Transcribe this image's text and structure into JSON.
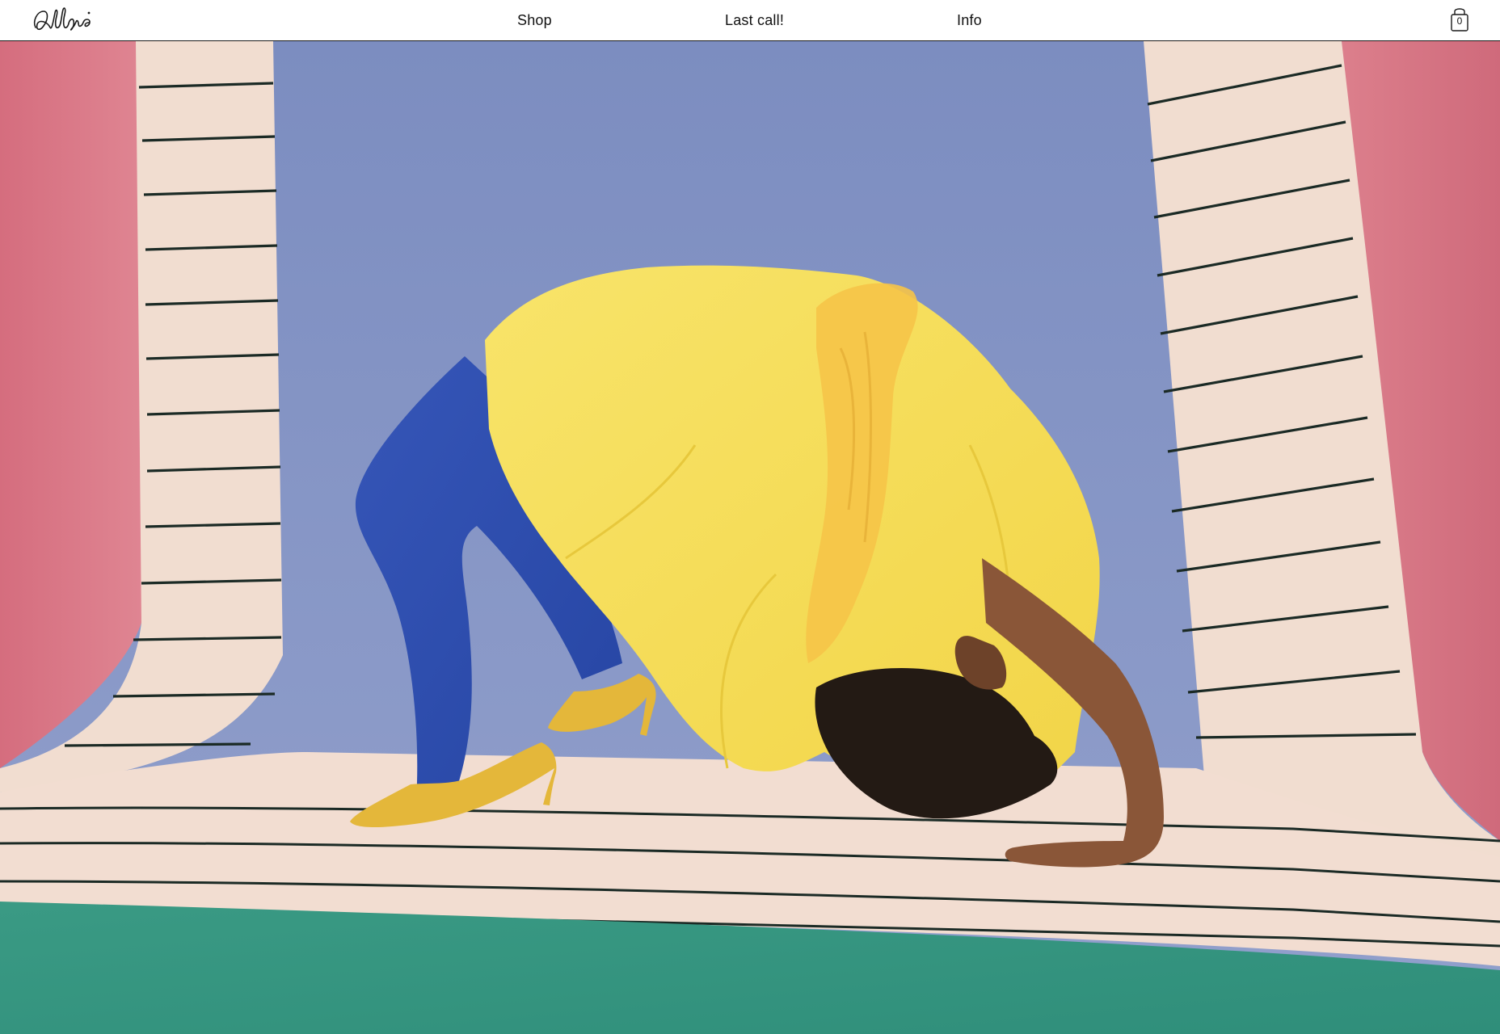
{
  "header": {
    "logo_text": "Aelfie",
    "nav": {
      "shop": "Shop",
      "last_call": "Last call!",
      "info": "Info"
    },
    "cart_count": "0"
  },
  "hero": {
    "icon": "hero-photo-model-backbend-on-striped-rug"
  },
  "colors": {
    "header_bg": "#ffffff",
    "text": "#111111",
    "pink_wall": "#d97383",
    "blue_wall": "#8796c4",
    "rug_cream": "#f1ddd0",
    "stripe": "#1b2a25",
    "floor_green": "#3f9f86",
    "dress_yellow": "#f7df56",
    "tights_blue": "#2f4fb0",
    "shoe_mustard": "#e6b93c"
  }
}
